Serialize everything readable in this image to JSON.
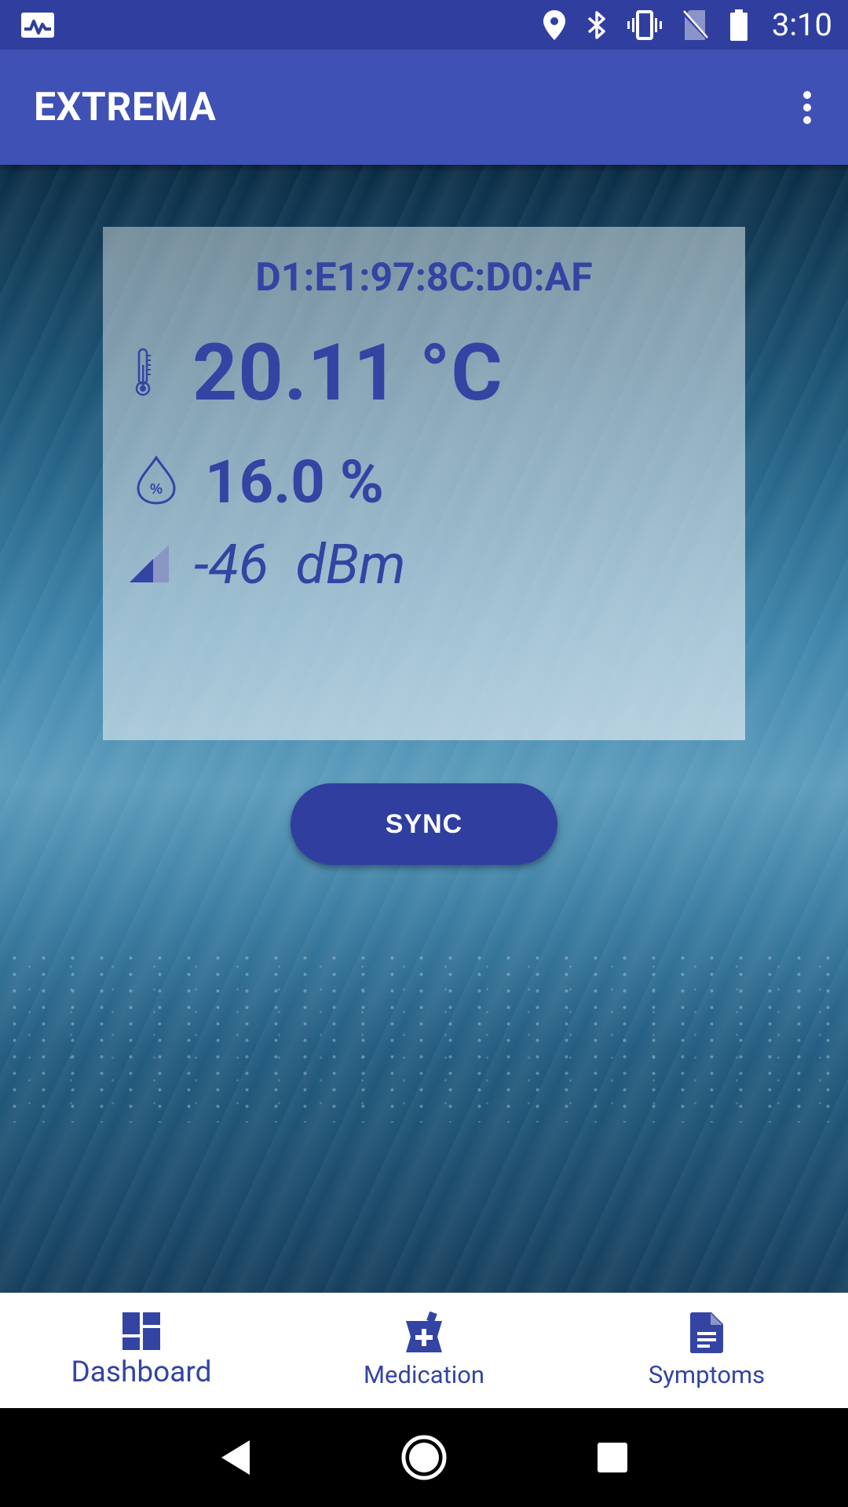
{
  "status_bar": {
    "time": "3:10",
    "icons": [
      "activity-icon",
      "location-icon",
      "bluetooth-icon",
      "vibrate-icon",
      "no-sim-icon",
      "battery-icon"
    ]
  },
  "app_bar": {
    "title": "EXTREMA",
    "overflow_icon": "more-vert-icon"
  },
  "sensor": {
    "mac_address": "D1:E1:97:8C:D0:AF",
    "temperature": "20.11 °C",
    "humidity": "16.0 %",
    "signal": "-46  dBm",
    "icons": [
      "thermometer-icon",
      "humidity-drop-icon",
      "signal-icon"
    ]
  },
  "actions": {
    "sync_label": "SYNC"
  },
  "bottom_nav": {
    "items": [
      {
        "label": "Dashboard",
        "icon": "dashboard-icon",
        "active": true
      },
      {
        "label": "Medication",
        "icon": "medication-icon",
        "active": false
      },
      {
        "label": "Symptoms",
        "icon": "document-icon",
        "active": false
      }
    ]
  },
  "colors": {
    "primary": "#3F51B5",
    "primary_dark": "#303F9F",
    "accent_text": "#3344A3"
  }
}
